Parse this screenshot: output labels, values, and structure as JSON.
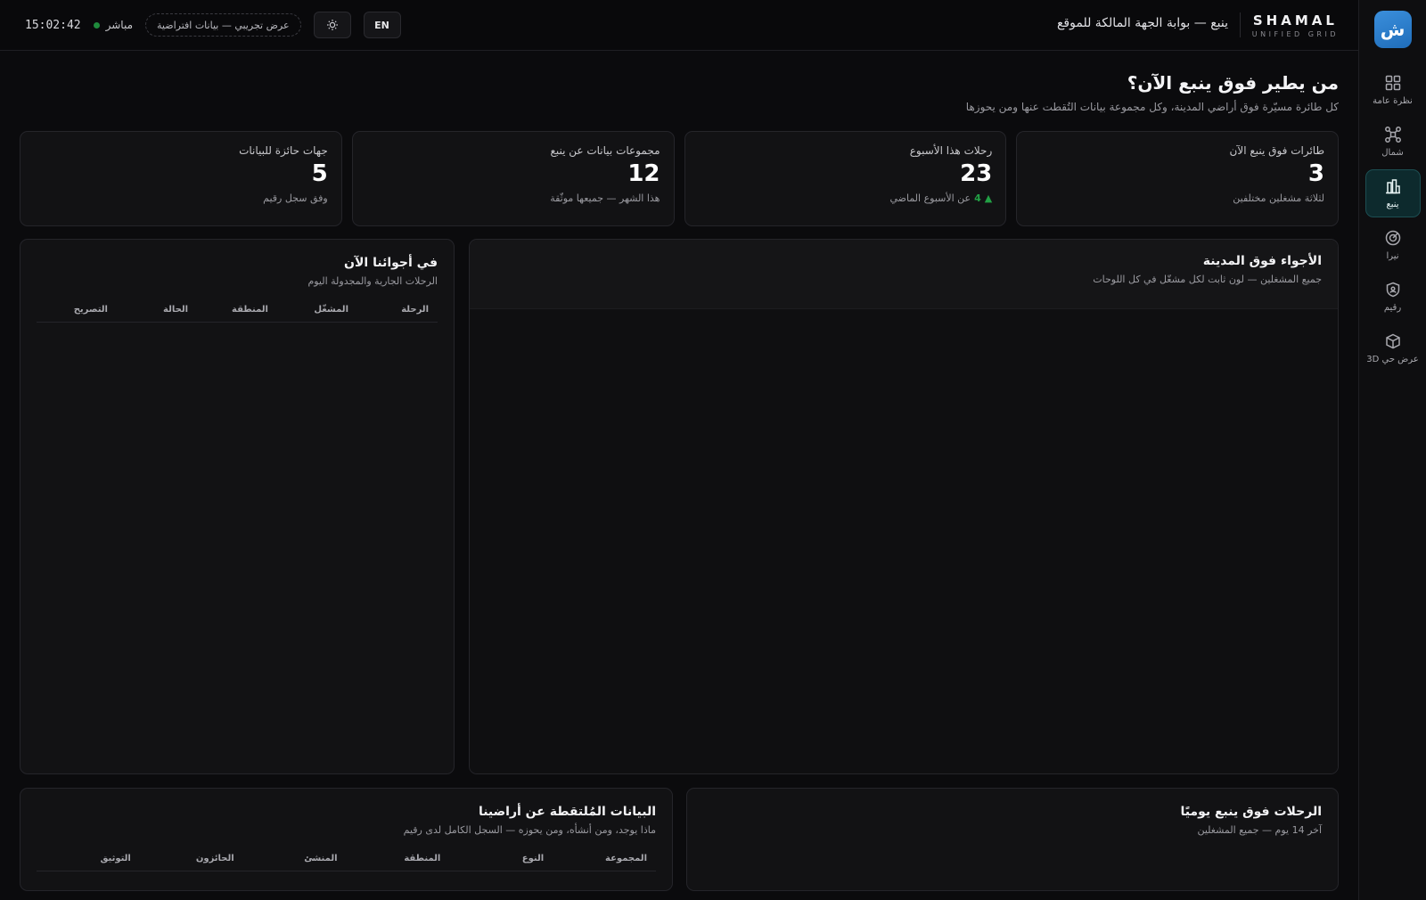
{
  "sidebar": {
    "logo": "ش",
    "items": [
      {
        "label": "نظرة عامة",
        "icon": "grid-icon"
      },
      {
        "label": "شمال",
        "icon": "drone-icon"
      },
      {
        "label": "ينبع",
        "icon": "city-icon",
        "active": true
      },
      {
        "label": "نيرا",
        "icon": "target-icon"
      },
      {
        "label": "رقيم",
        "icon": "shield-icon"
      },
      {
        "label": "عرض حي 3D",
        "icon": "cube-icon"
      }
    ]
  },
  "topbar": {
    "brand_name": "SHAMAL",
    "brand_sub": "UNIFIED GRID",
    "portal_title": "ينبع — بوابة الجهة المالكة للموقع",
    "lang_button": "EN",
    "theme_icon": "sun-icon",
    "demo_badge": "عرض تجريبي — بيانات افتراضية",
    "live_label": "مباشر",
    "clock": "15:02:42"
  },
  "page": {
    "title": "من يطير فوق ينبع الآن؟",
    "subtitle": "كل طائرة مسيّرة فوق أراضي المدينة، وكل مجموعة بيانات التُقطت عنها ومن يحوزها"
  },
  "kpis": [
    {
      "label": "طائرات فوق ينبع الآن",
      "value": "3",
      "foot": "لثلاثة مشغلين مختلفين"
    },
    {
      "label": "رحلات هذا الأسبوع",
      "value": "23",
      "foot_num": "4",
      "foot": "عن الأسبوع الماضي"
    },
    {
      "label": "مجموعات بيانات عن ينبع",
      "value": "12",
      "foot": "هذا الشهر — جميعها موثّقة"
    },
    {
      "label": "جهات حائزة للبيانات",
      "value": "5",
      "foot": "وفق سجل رقيم"
    }
  ],
  "map_panel": {
    "title": "الأجواء فوق المدينة",
    "subtitle": "جميع المشغلين — لون ثابت لكل مشغّل في كل اللوحات"
  },
  "sky_panel": {
    "title": "في أجوائنا الآن",
    "subtitle": "الرحلات الجارية والمجدولة اليوم",
    "columns": [
      "الرحلة",
      "المشغّل",
      "المنطقة",
      "الحالة",
      "التصريح"
    ]
  },
  "daily_panel": {
    "title": "الرحلات فوق ينبع يوميًا",
    "subtitle": "آخر 14 يوم — جميع المشغلين"
  },
  "data_panel": {
    "title": "البيانات المُلتقطة عن أراضينا",
    "subtitle": "ماذا يوجد، ومن أنشأه، ومن يحوزه — السجل الكامل لدى رقيم",
    "columns": [
      "المجموعة",
      "النوع",
      "المنطقة",
      "المنشئ",
      "الحائزون",
      "التوثيق"
    ]
  }
}
